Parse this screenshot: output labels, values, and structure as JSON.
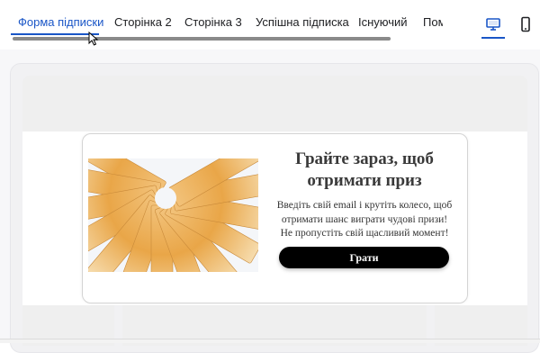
{
  "tabs": [
    {
      "label": "Форма підписки",
      "active": true
    },
    {
      "label": "Сторінка 2",
      "active": false
    },
    {
      "label": "Сторінка 3",
      "active": false
    },
    {
      "label": "Успішна підписка",
      "active": false
    },
    {
      "label": "Існуючий",
      "active": false
    },
    {
      "label": "Пом",
      "active": false
    }
  ],
  "device_toggle": {
    "desktop": {
      "icon": "desktop-icon",
      "active": true
    },
    "mobile": {
      "icon": "mobile-icon",
      "active": false
    }
  },
  "popup": {
    "image": {
      "icon": "euro-banknotes-fan-image"
    },
    "title": "Грайте зараз, щоб отримати приз",
    "text": "Введіть свій email і крутіть колесо, щоб отримати шанс виграти чудові призи! Не пропустіть свій щасливий момент!",
    "button_label": "Грати"
  },
  "colors": {
    "accent": "#1a56c7",
    "button_bg": "#000000",
    "title_text": "#3a3a3a"
  }
}
